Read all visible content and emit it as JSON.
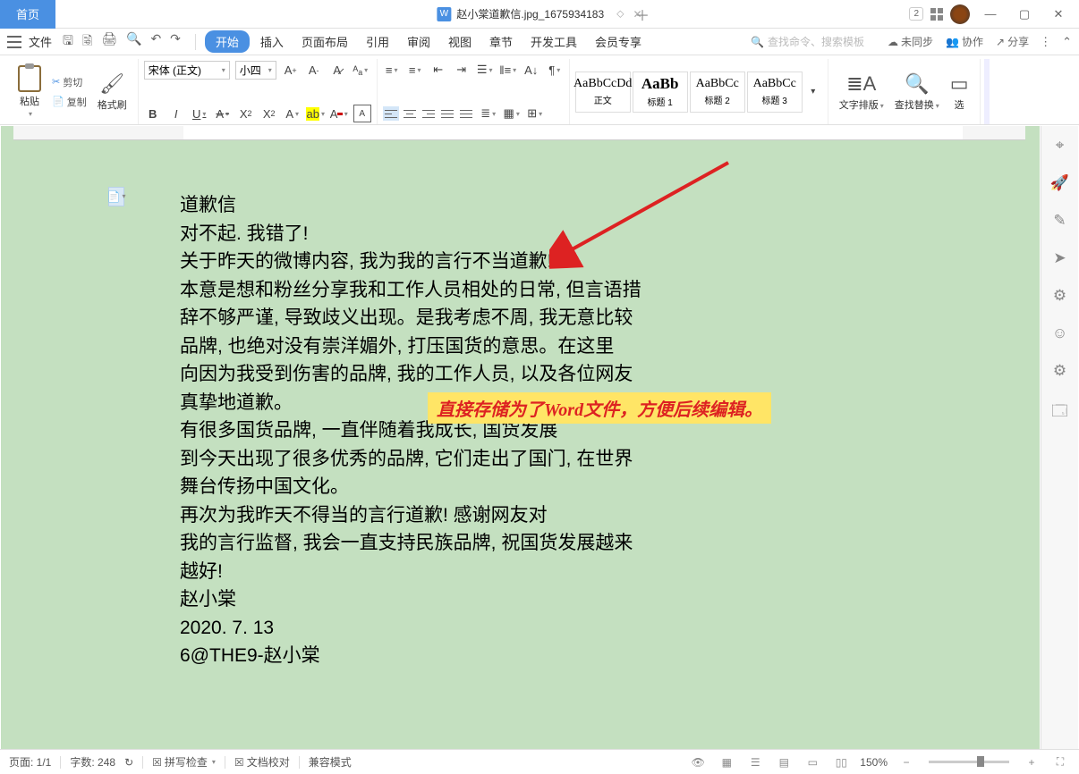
{
  "titlebar": {
    "home": "首页",
    "doc_name": "赵小棠道歉信.jpg_1675934183",
    "badge": "2"
  },
  "menubar": {
    "file": "文件",
    "tabs": [
      "开始",
      "插入",
      "页面布局",
      "引用",
      "审阅",
      "视图",
      "章节",
      "开发工具",
      "会员专享"
    ],
    "search_placeholder": "查找命令、搜索模板",
    "unsync": "未同步",
    "collab": "协作",
    "share": "分享"
  },
  "ribbon": {
    "paste": "粘贴",
    "cut": "剪切",
    "copy": "复制",
    "format_painter": "格式刷",
    "font_name": "宋体 (正文)",
    "font_size": "小四",
    "styles": [
      {
        "prev": "AaBbCcDd",
        "name": "正文"
      },
      {
        "prev": "AaBb",
        "name": "标题 1"
      },
      {
        "prev": "AaBbCc",
        "name": "标题 2"
      },
      {
        "prev": "AaBbCc",
        "name": "标题 3"
      }
    ],
    "text_layout": "文字排版",
    "find_replace": "查找替换",
    "select": "选"
  },
  "document": {
    "lines": [
      "道歉信",
      "对不起. 我错了!",
      "关于昨天的微博内容, 我为我的言行不当道歉!",
      "本意是想和粉丝分享我和工作人员相处的日常, 但言语措",
      "辞不够严谨, 导致歧义出现。是我考虑不周, 我无意比较",
      "品牌, 也绝对没有崇洋媚外, 打压国货的意思。在这里",
      "向因为我受到伤害的品牌, 我的工作人员, 以及各位网友",
      "真挚地道歉。",
      "有很多国货品牌, 一直伴随着我成长, 国货发展",
      "到今天出现了很多优秀的品牌, 它们走出了国门, 在世界",
      "舞台传扬中国文化。",
      "再次为我昨天不得当的言行道歉! 感谢网友对",
      "我的言行监督, 我会一直支持民族品牌, 祝国货发展越来",
      "越好!",
      "赵小棠",
      "2020. 7. 13",
      "6@THE9-赵小棠"
    ]
  },
  "annotation": "直接存储为了Word文件，方便后续编辑。",
  "statusbar": {
    "page": "页面: 1/1",
    "words": "字数: 248",
    "spellcheck": "拼写检查",
    "proofread": "文档校对",
    "compat": "兼容模式",
    "zoom": "150%"
  }
}
